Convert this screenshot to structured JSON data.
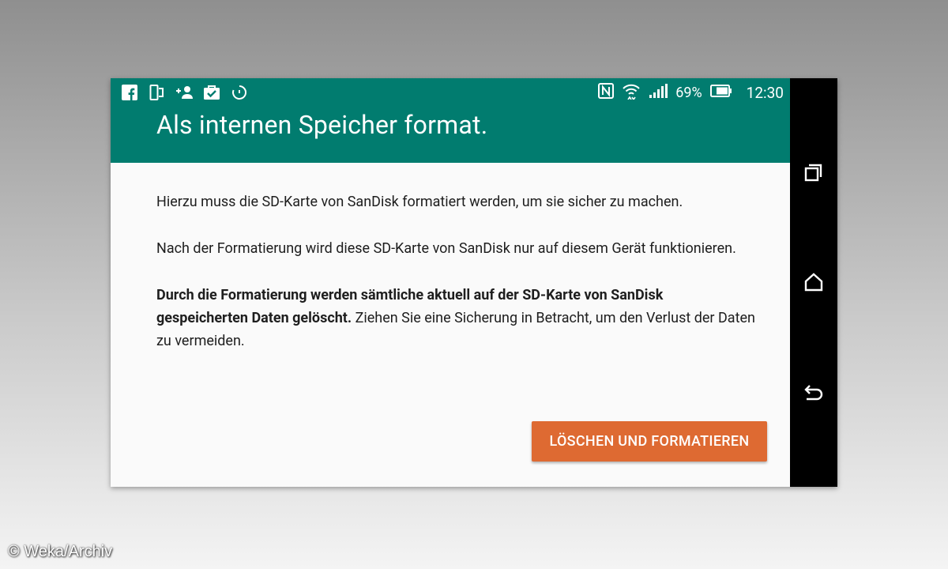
{
  "statusbar": {
    "left_icons": [
      "facebook-icon",
      "dual-screen-icon",
      "add-person-icon",
      "briefcase-check-icon",
      "sync-icon"
    ],
    "right_icons": [
      "nfc-icon",
      "wifi-icon",
      "signal-icon"
    ],
    "battery_percent": "69%",
    "time": "12:30"
  },
  "dialog": {
    "title": "Als internen Speicher format.",
    "paragraph1": "Hierzu muss die SD-Karte von SanDisk formatiert werden, um sie sicher zu machen.",
    "paragraph2": "Nach der Formatierung wird diese SD-Karte von SanDisk nur auf diesem Gerät funktionieren.",
    "paragraph3_bold": "Durch die Formatierung werden sämtliche aktuell auf der SD-Karte von SanDisk gespeicherten Daten gelöscht.",
    "paragraph3_rest": " Ziehen Sie eine Sicherung in Betracht, um den Verlust der Daten zu vermeiden.",
    "action_label": "LÖSCHEN UND FORMATIEREN"
  },
  "navbar": {
    "buttons": [
      "recents-icon",
      "home-icon",
      "back-icon"
    ]
  },
  "colors": {
    "appbar": "#017c6f",
    "action": "#de6a32"
  },
  "watermark": "© Weka/Archiv"
}
